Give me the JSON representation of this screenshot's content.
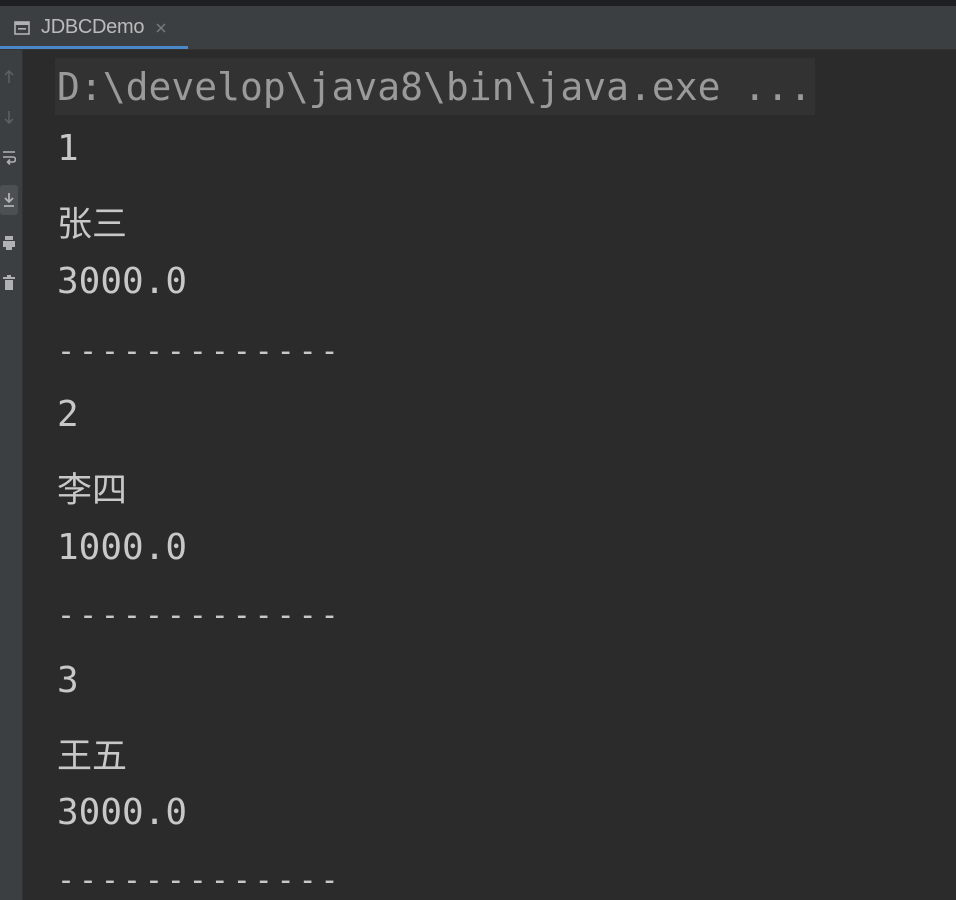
{
  "tab": {
    "label": "JDBCDemo",
    "icon": "console-window-icon",
    "close_icon": "close-icon"
  },
  "gutter": {
    "icons": [
      "arrow-up-icon",
      "arrow-down-icon",
      "soft-wrap-icon",
      "scroll-to-end-icon",
      "print-icon",
      "trash-icon"
    ]
  },
  "console": {
    "command": "D:\\develop\\java8\\bin\\java.exe ...",
    "lines": [
      {
        "text": "1",
        "kind": "mono"
      },
      {
        "text": "张三",
        "kind": "cjk"
      },
      {
        "text": "3000.0",
        "kind": "mono"
      },
      {
        "text": "-------------",
        "kind": "dash"
      },
      {
        "text": "2",
        "kind": "mono"
      },
      {
        "text": "李四",
        "kind": "cjk"
      },
      {
        "text": "1000.0",
        "kind": "mono"
      },
      {
        "text": "-------------",
        "kind": "dash"
      },
      {
        "text": "3",
        "kind": "mono"
      },
      {
        "text": "王五",
        "kind": "cjk"
      },
      {
        "text": "3000.0",
        "kind": "mono"
      },
      {
        "text": "-------------",
        "kind": "dash"
      }
    ]
  },
  "colors": {
    "background": "#2b2b2b",
    "tabbar": "#3c3f41",
    "accent": "#4a88c7",
    "text": "#c8c8c8",
    "command_text": "#9a9a9a"
  }
}
